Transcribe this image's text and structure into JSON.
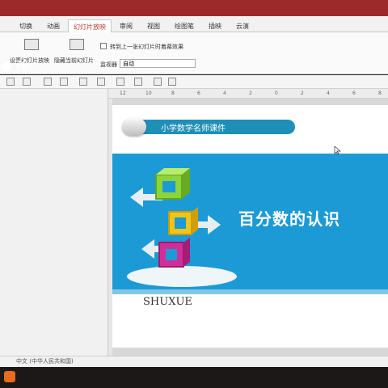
{
  "ribbon": {
    "tabs": [
      "切换",
      "动画",
      "幻灯片放映",
      "审阅",
      "视图",
      "绘图笔",
      "插映",
      "云演"
    ],
    "active_tab_index": 2,
    "set_show_label": "设置幻灯片放映",
    "hide_slide_label": "隐藏当前幻灯片",
    "switch_option_label": "转到上一张幻灯片时着幕效果",
    "monitor_label": "监视器",
    "monitor_value": "自动"
  },
  "viewer": {
    "count": "76"
  },
  "ruler": {
    "ticks": [
      "12",
      "10",
      "8",
      "6",
      "4",
      "2",
      "0",
      "2",
      "4",
      "6",
      "8"
    ]
  },
  "slide": {
    "header": "小学数学名师课件",
    "title": "百分数的认识",
    "subtitle": "SHUXUE"
  },
  "status": {
    "language": "中文 (中华人民共和国)"
  },
  "colors": {
    "accent": "#1c9ad6",
    "header_pill": "#1e8fb7",
    "topbar": "#9c2a2a"
  }
}
